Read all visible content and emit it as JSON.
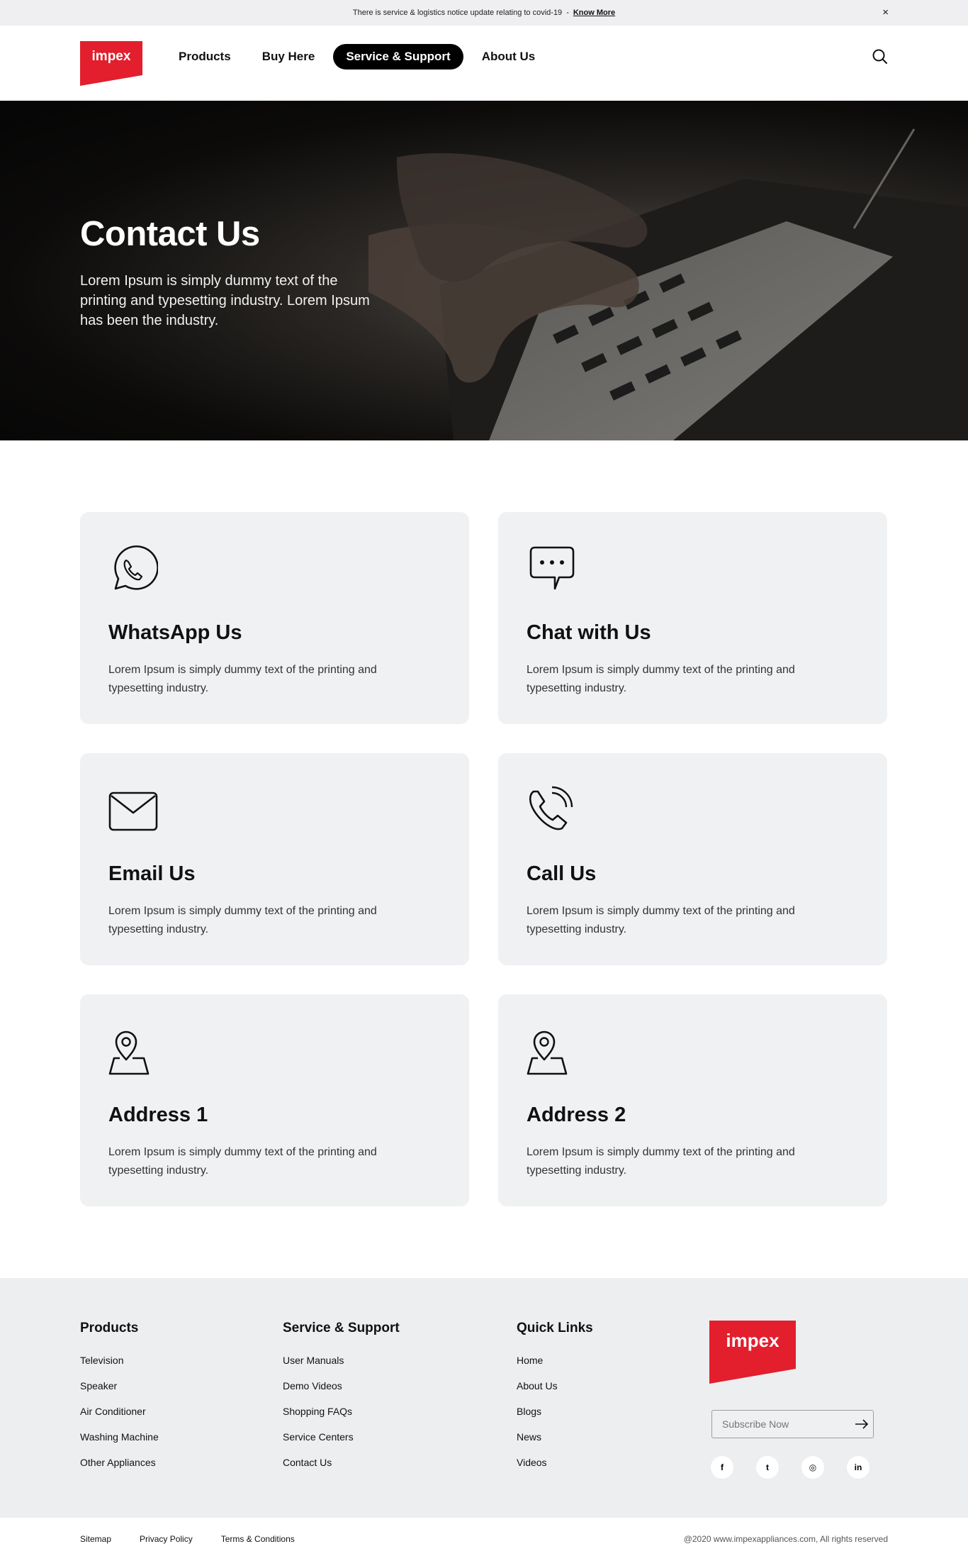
{
  "notice": {
    "text": "There is service & logistics notice update relating to covid-19",
    "separator": "-",
    "link": "Know More",
    "close": "×"
  },
  "header": {
    "logo_text": "impex",
    "nav": [
      {
        "label": "Products",
        "active": false
      },
      {
        "label": "Buy Here",
        "active": false
      },
      {
        "label": "Service & Support",
        "active": true
      },
      {
        "label": "About Us",
        "active": false
      }
    ],
    "search_icon": "search-icon"
  },
  "hero": {
    "title": "Contact Us",
    "text": "Lorem Ipsum is simply dummy text of the printing and typesetting industry. Lorem Ipsum has been the industry."
  },
  "cards": [
    {
      "icon": "whatsapp-icon",
      "title": "WhatsApp Us",
      "text": "Lorem Ipsum is simply dummy text of the printing and typesetting industry."
    },
    {
      "icon": "chat-icon",
      "title": "Chat with Us",
      "text": "Lorem Ipsum is simply dummy text of the printing and typesetting industry."
    },
    {
      "icon": "email-icon",
      "title": "Email Us",
      "text": "Lorem Ipsum is simply dummy text of the printing and typesetting industry."
    },
    {
      "icon": "phone-icon",
      "title": "Call Us",
      "text": "Lorem Ipsum is simply dummy text of the printing and typesetting industry."
    },
    {
      "icon": "location-pin-icon",
      "title": "Address 1",
      "text": "Lorem Ipsum is simply dummy text of the printing and typesetting industry."
    },
    {
      "icon": "location-pin-icon",
      "title": "Address 2",
      "text": "Lorem Ipsum is simply dummy text of the printing and typesetting industry."
    }
  ],
  "footer": {
    "products": {
      "heading": "Products",
      "links": [
        "Television",
        "Speaker",
        "Air Conditioner",
        "Washing Machine",
        "Other Appliances"
      ]
    },
    "service": {
      "heading": "Service & Support",
      "links": [
        "User Manuals",
        "Demo Videos",
        "Shopping FAQs",
        "Service Centers",
        "Contact Us"
      ]
    },
    "quick": {
      "heading": "Quick Links",
      "links": [
        "Home",
        "About Us",
        "Blogs",
        "News",
        "Videos"
      ]
    },
    "logo_text": "impex",
    "subscribe_placeholder": "Subscribe Now",
    "social": [
      {
        "icon": "facebook-icon",
        "glyph": "f"
      },
      {
        "icon": "twitter-icon",
        "glyph": "t"
      },
      {
        "icon": "instagram-icon",
        "glyph": "◎"
      },
      {
        "icon": "linkedin-icon",
        "glyph": "in"
      }
    ]
  },
  "bottom": {
    "links": [
      "Sitemap",
      "Privacy Policy",
      "Terms & Conditions"
    ],
    "copyright": "@2020 www.impexappliances.com, All rights reserved"
  },
  "colors": {
    "brand_red": "#e31e2d",
    "card_bg": "#f0f1f3",
    "footer_bg": "#eceef0",
    "active_nav_bg": "#000000"
  }
}
